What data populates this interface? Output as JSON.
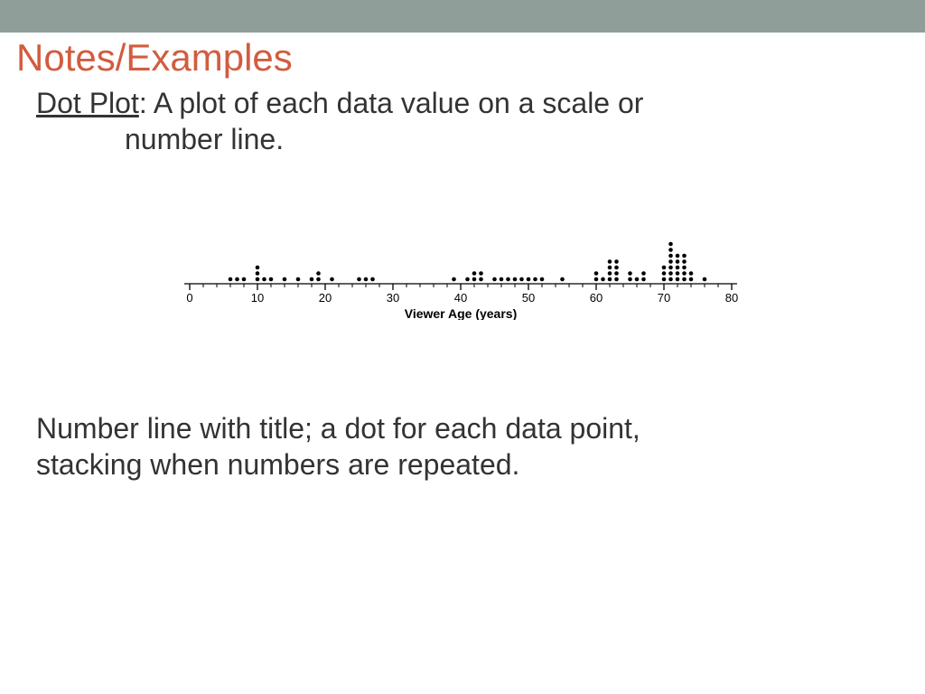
{
  "header": {
    "title": "Notes/Examples"
  },
  "definition": {
    "term": "Dot Plot",
    "rest_line1": ": A plot of each data value on a scale or",
    "line2": "number line."
  },
  "explanation": {
    "line1": "Number line with title; a dot for each data point,",
    "line2": "stacking when numbers are repeated."
  },
  "chart_data": {
    "type": "dot",
    "xlabel": "Viewer Age (years)",
    "xlim": [
      0,
      80
    ],
    "ticks": [
      0,
      10,
      20,
      30,
      40,
      50,
      60,
      70,
      80
    ],
    "points": [
      {
        "x": 6,
        "count": 1
      },
      {
        "x": 7,
        "count": 1
      },
      {
        "x": 8,
        "count": 1
      },
      {
        "x": 10,
        "count": 3
      },
      {
        "x": 11,
        "count": 1
      },
      {
        "x": 12,
        "count": 1
      },
      {
        "x": 14,
        "count": 1
      },
      {
        "x": 16,
        "count": 1
      },
      {
        "x": 18,
        "count": 1
      },
      {
        "x": 19,
        "count": 2
      },
      {
        "x": 21,
        "count": 1
      },
      {
        "x": 25,
        "count": 1
      },
      {
        "x": 26,
        "count": 1
      },
      {
        "x": 27,
        "count": 1
      },
      {
        "x": 39,
        "count": 1
      },
      {
        "x": 41,
        "count": 1
      },
      {
        "x": 42,
        "count": 2
      },
      {
        "x": 43,
        "count": 2
      },
      {
        "x": 45,
        "count": 1
      },
      {
        "x": 46,
        "count": 1
      },
      {
        "x": 47,
        "count": 1
      },
      {
        "x": 48,
        "count": 1
      },
      {
        "x": 49,
        "count": 1
      },
      {
        "x": 50,
        "count": 1
      },
      {
        "x": 51,
        "count": 1
      },
      {
        "x": 52,
        "count": 1
      },
      {
        "x": 55,
        "count": 1
      },
      {
        "x": 60,
        "count": 2
      },
      {
        "x": 61,
        "count": 1
      },
      {
        "x": 62,
        "count": 4
      },
      {
        "x": 63,
        "count": 4
      },
      {
        "x": 65,
        "count": 2
      },
      {
        "x": 66,
        "count": 1
      },
      {
        "x": 67,
        "count": 2
      },
      {
        "x": 70,
        "count": 3
      },
      {
        "x": 71,
        "count": 7
      },
      {
        "x": 72,
        "count": 5
      },
      {
        "x": 73,
        "count": 5
      },
      {
        "x": 74,
        "count": 2
      },
      {
        "x": 76,
        "count": 1
      }
    ]
  }
}
